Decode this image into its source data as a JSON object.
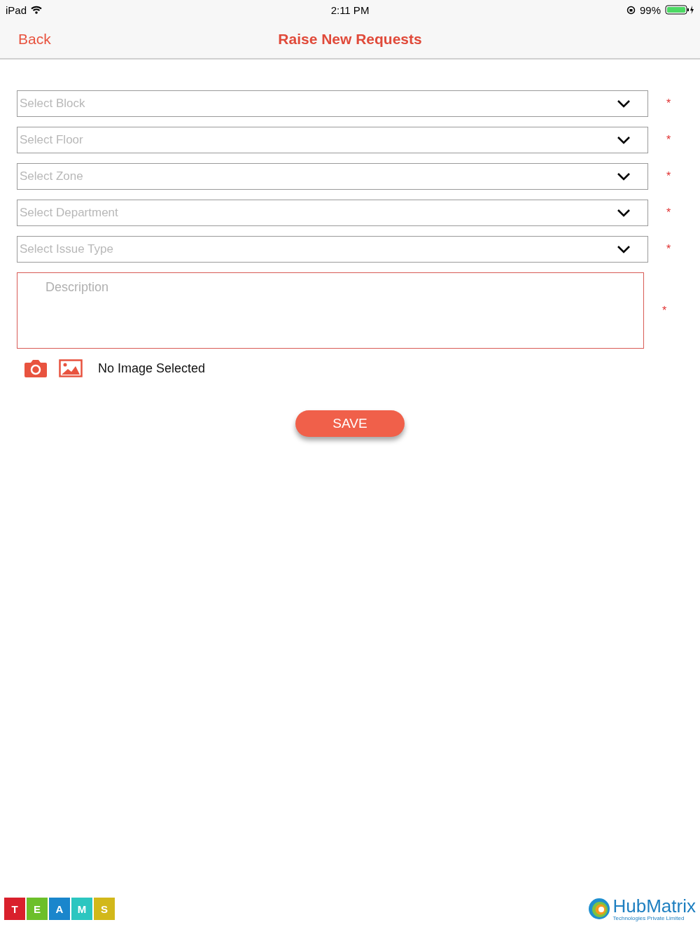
{
  "status_bar": {
    "device": "iPad",
    "time": "2:11 PM",
    "battery": "99%"
  },
  "nav": {
    "back": "Back",
    "title": "Raise New Requests"
  },
  "fields": [
    {
      "placeholder": "Select Block",
      "required": "*"
    },
    {
      "placeholder": "Select Floor",
      "required": "*"
    },
    {
      "placeholder": "Select Zone",
      "required": "*"
    },
    {
      "placeholder": "Select Department",
      "required": "*"
    },
    {
      "placeholder": "Select Issue Type",
      "required": "*"
    }
  ],
  "description": {
    "placeholder": "Description",
    "required": "*"
  },
  "image": {
    "status": "No Image Selected"
  },
  "save_button": "SAVE",
  "footer": {
    "teams_logo": [
      {
        "letter": "T",
        "color": "#d9202c"
      },
      {
        "letter": "E",
        "color": "#6cbf2a"
      },
      {
        "letter": "A",
        "color": "#1a86cc"
      },
      {
        "letter": "M",
        "color": "#2cc6c0"
      },
      {
        "letter": "S",
        "color": "#d2b81a"
      }
    ],
    "company": "HubMatrix",
    "company_tagline": "Technologies Private Limited"
  }
}
